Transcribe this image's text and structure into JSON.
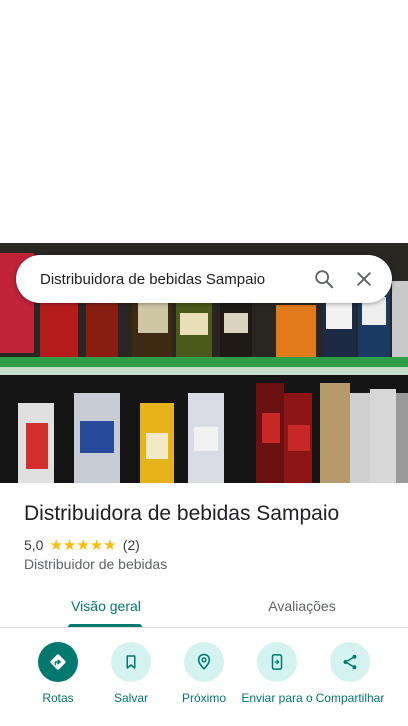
{
  "search": {
    "query": "Distribuidora de bebidas Sampaio"
  },
  "place": {
    "name": "Distribuidora de bebidas Sampaio",
    "rating": "5,0",
    "stars": [
      "★",
      "★",
      "★",
      "★",
      "★"
    ],
    "review_count": "(2)",
    "category": "Distribuidor de bebidas"
  },
  "tabs": [
    {
      "label": "Visão geral",
      "selected": true
    },
    {
      "label": "Avaliações",
      "selected": false
    }
  ],
  "actions": [
    {
      "label": "Rotas",
      "icon": "directions-icon"
    },
    {
      "label": "Salvar",
      "icon": "bookmark-icon"
    },
    {
      "label": "Próximo",
      "icon": "nearby-icon"
    },
    {
      "label": "Enviar para o",
      "icon": "send-to-phone-icon"
    },
    {
      "label": "Compartilhar",
      "icon": "share-icon"
    }
  ],
  "colors": {
    "accent": "#01796f",
    "accent_light": "#d3f2f0",
    "star": "#fbbc04"
  }
}
